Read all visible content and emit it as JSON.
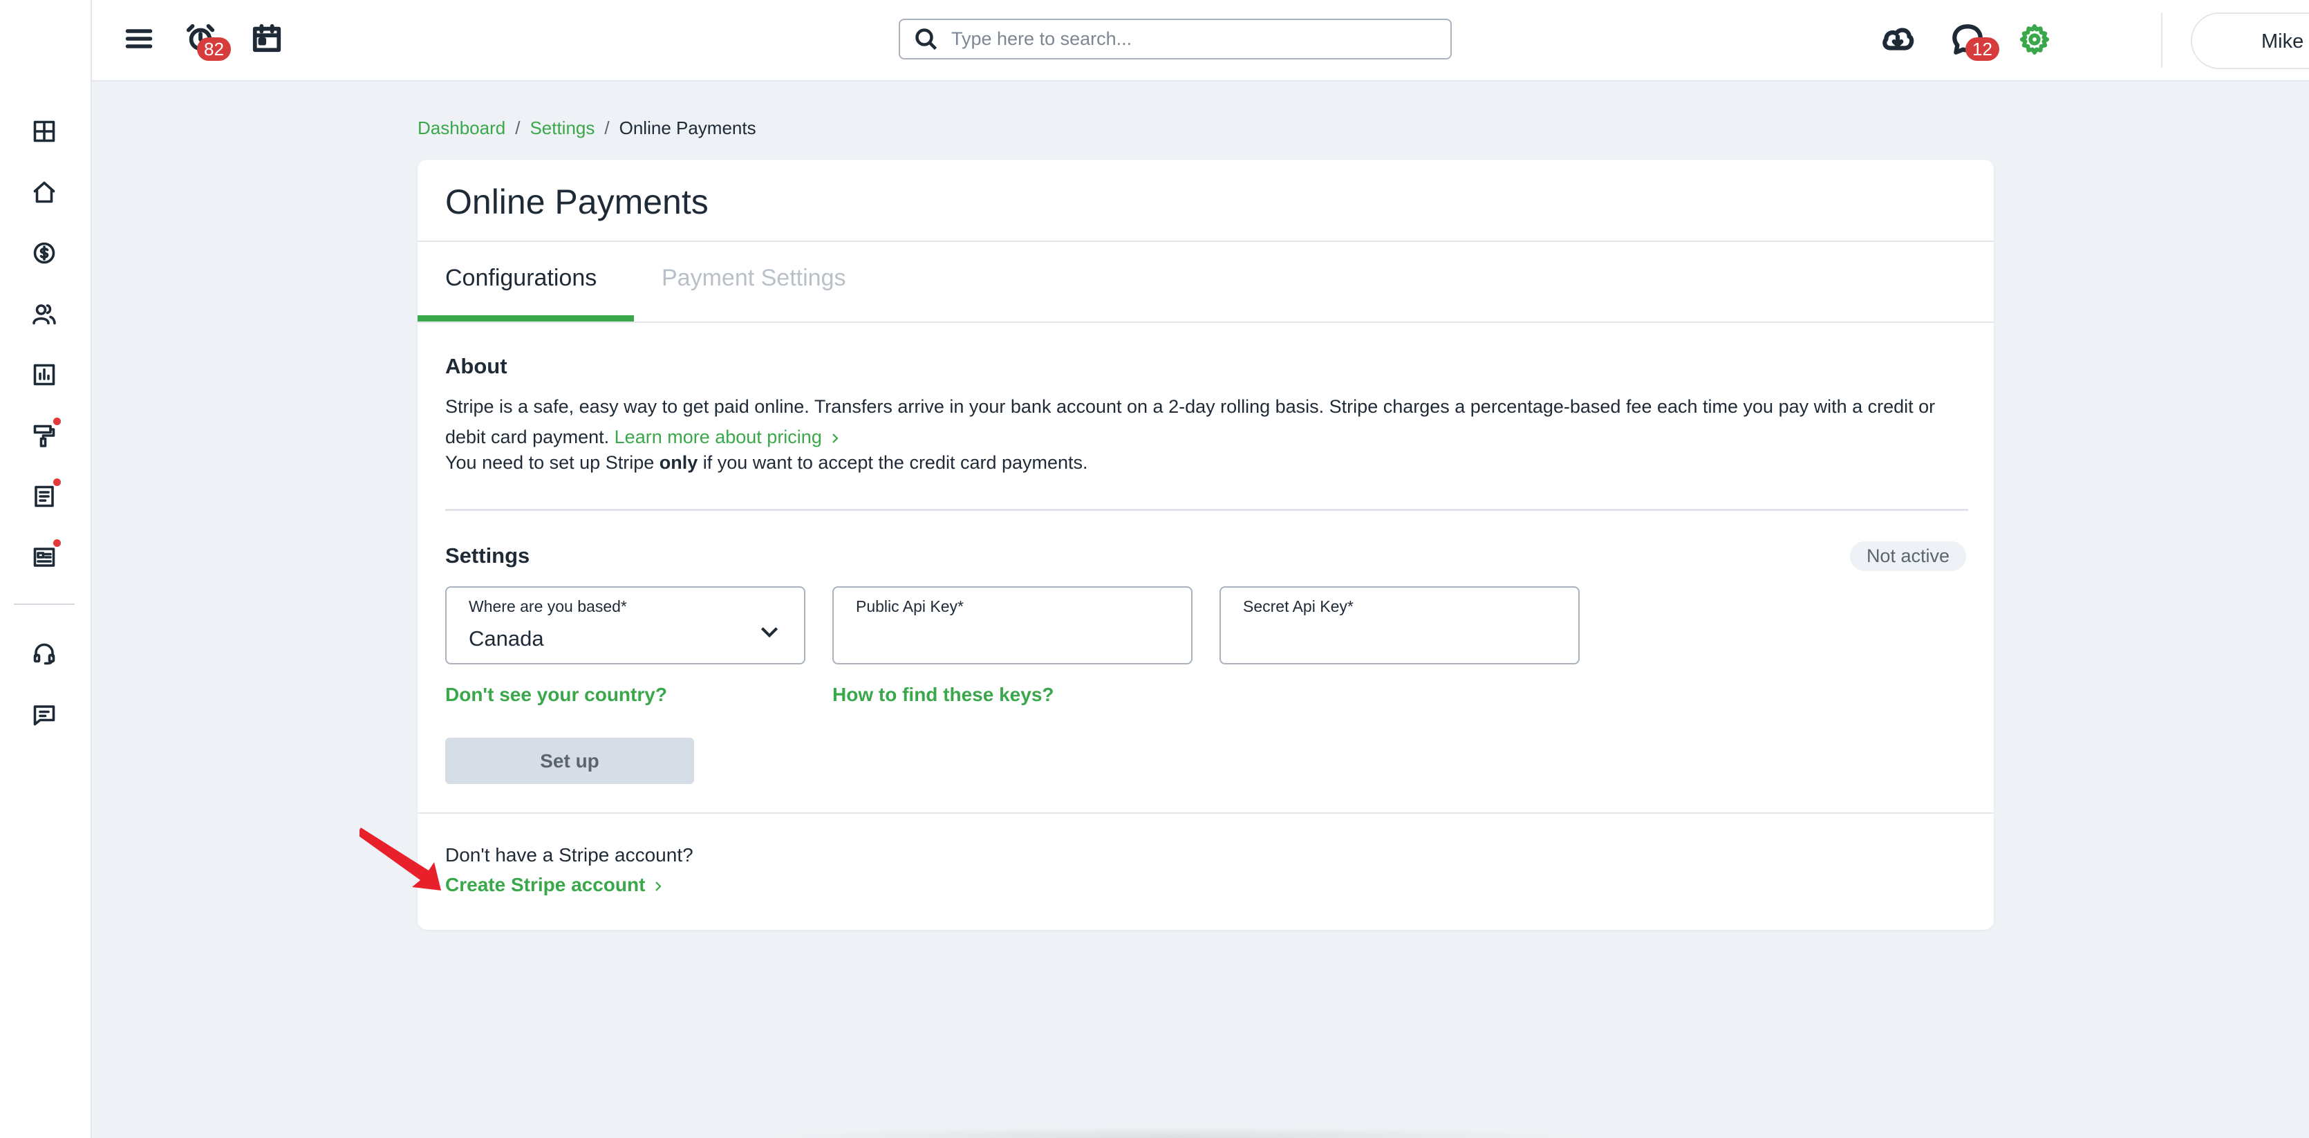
{
  "topbar": {
    "alarm_badge": "82",
    "search_placeholder": "Type here to search...",
    "chat_badge": "12",
    "user_name": "Mike"
  },
  "breadcrumb": {
    "items": [
      "Dashboard",
      "Settings"
    ],
    "current": "Online Payments",
    "separator": "/"
  },
  "page": {
    "title": "Online Payments",
    "tabs": [
      {
        "label": "Configurations",
        "active": true
      },
      {
        "label": "Payment Settings",
        "active": false
      }
    ]
  },
  "about": {
    "heading": "About",
    "text": "Stripe is a safe, easy way to get paid online. Transfers arrive in your bank account on a 2-day rolling basis. Stripe charges a percentage-based fee each time you pay with a credit or debit card payment.",
    "pricing_link": "Learn more about pricing",
    "note_before": "You need to set up Stripe ",
    "note_bold": "only",
    "note_after": " if you want to accept the credit card payments."
  },
  "settings": {
    "heading": "Settings",
    "status": "Not active",
    "country_label": "Where are you based*",
    "country_value": "Canada",
    "public_key_label": "Public Api Key*",
    "public_key_value": "",
    "secret_key_label": "Secret Api Key*",
    "secret_key_value": "",
    "country_help_link": "Don't see your country?",
    "keys_help_link": "How to find these keys?",
    "setup_button": "Set up"
  },
  "footer": {
    "question": "Don't have a Stripe account?",
    "create_link": "Create Stripe account"
  },
  "colors": {
    "accent": "#3aa84a",
    "badge": "#d63c3c",
    "background": "#eef1f5",
    "annotation_arrow": "#e8202a"
  }
}
